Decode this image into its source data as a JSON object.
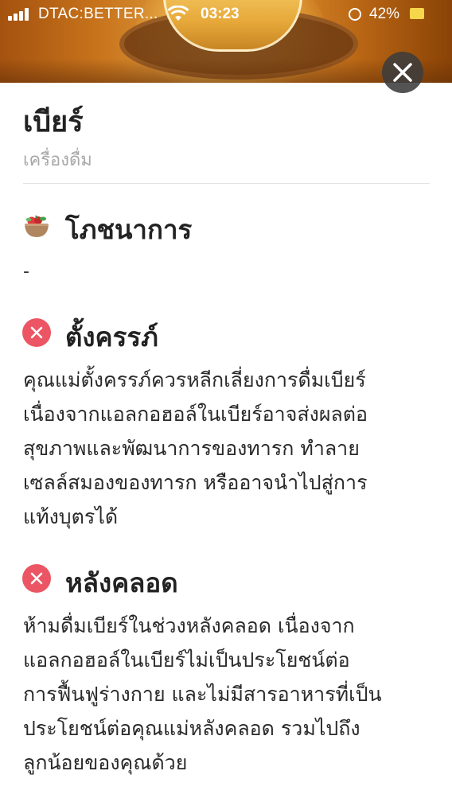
{
  "status_bar": {
    "carrier": "DTAC:BETTER...",
    "time": "03:23",
    "battery": "42%"
  },
  "product": {
    "title": "เบียร์",
    "category": "เครื่องดื่ม"
  },
  "sections": {
    "nutrition": {
      "icon": "salad-bowl-icon",
      "title": "โภชนาการ",
      "value": "-"
    },
    "pregnancy": {
      "icon": "x-circle-icon",
      "title": "ตั้งครรภ์",
      "lines": [
        "คุณแม่ตั้งครรภ์ควรหลีกเลี่ยงการดื่มเบียร์",
        "เนื่องจากแอลกอฮอล์ในเบียร์อาจส่งผลต่อ",
        "สุขภาพและพัฒนาการของทารก ทำลาย",
        "เซลล์สมองของทารก หรืออาจนำไปสู่การ",
        "แท้งบุตรได้"
      ]
    },
    "postpartum": {
      "icon": "x-circle-icon",
      "title": "หลังคลอด",
      "lines": [
        "ห้ามดื่มเบียร์ในช่วงหลังคลอด เนื่องจาก",
        "แอลกอฮอล์ในเบียร์ไม่เป็นประโยชน์ต่อ",
        "การฟื้นฟูร่างกาย และไม่มีสารอาหารที่เป็น",
        "ประโยชน์ต่อคุณแม่หลังคลอด รวมไปถึง",
        "ลูกน้อยของคุณด้วย"
      ]
    }
  },
  "colors": {
    "warning": "#ec5563",
    "close_button": "#3c3c3c"
  }
}
